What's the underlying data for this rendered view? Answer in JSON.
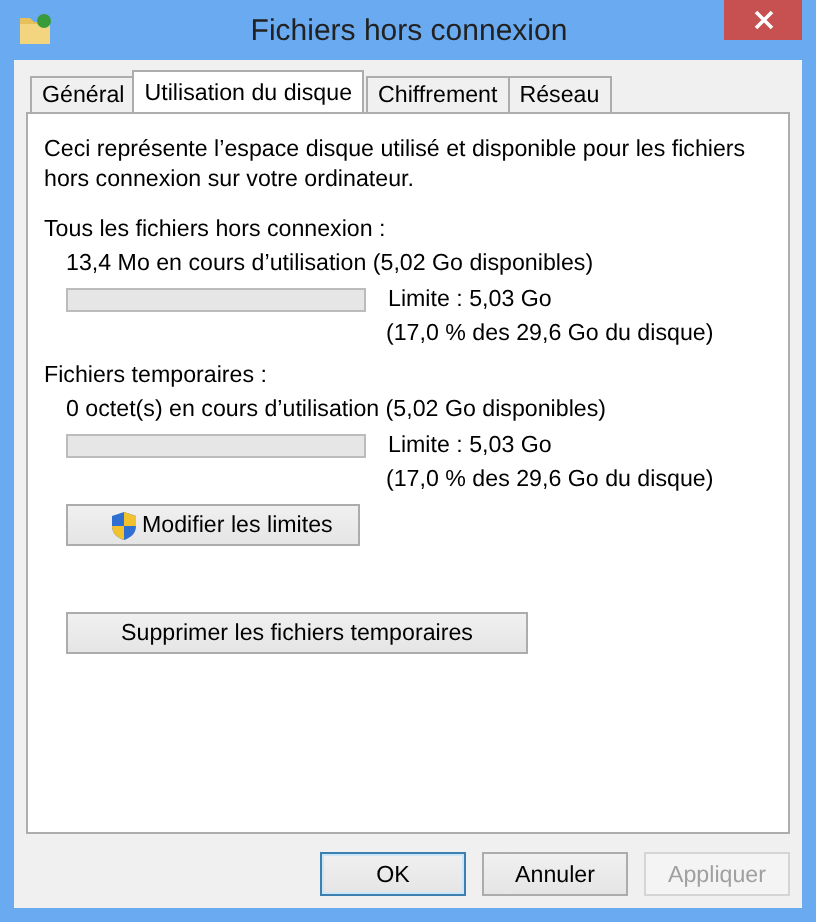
{
  "window": {
    "title": "Fichiers hors connexion"
  },
  "tabs": [
    {
      "label": "Général",
      "selected": false
    },
    {
      "label": "Utilisation du disque",
      "selected": true
    },
    {
      "label": "Chiffrement",
      "selected": false
    },
    {
      "label": "Réseau",
      "selected": false
    }
  ],
  "description": "Ceci représente l’espace disque utilisé et disponible pour les fichiers hors connexion sur votre ordinateur.",
  "sections": [
    {
      "heading": "Tous les fichiers hors connexion :",
      "usage": "13,4 Mo en cours d’utilisation (5,02 Go disponibles)",
      "level": 0,
      "limit": "Limite : 5,03 Go",
      "share": "(17,0 % des 29,6 Go du disque)"
    },
    {
      "heading": "Fichiers temporaires :",
      "usage": "0 octet(s) en cours d’utilisation (5,02 Go disponibles)",
      "level": 0,
      "limit": "Limite : 5,03 Go",
      "share": "(17,0 % des 29,6 Go du disque)"
    }
  ],
  "modify_button": {
    "label": "Modifier les limites"
  },
  "delete_button": {
    "label": "Supprimer les fichiers temporaires"
  },
  "buttons": [
    {
      "label": "OK",
      "default": true,
      "disabled": false
    },
    {
      "label": "Annuler",
      "default": false,
      "disabled": false
    },
    {
      "label": "Appliquer",
      "default": false,
      "disabled": true
    }
  ]
}
